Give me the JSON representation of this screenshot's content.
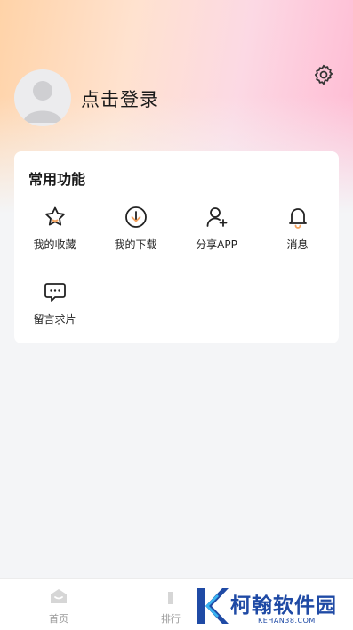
{
  "profile": {
    "login_text": "点击登录"
  },
  "features": {
    "title": "常用功能",
    "items": [
      {
        "label": "我的收藏",
        "icon": "star-icon"
      },
      {
        "label": "我的下载",
        "icon": "download-icon"
      },
      {
        "label": "分享APP",
        "icon": "user-add-icon"
      },
      {
        "label": "消息",
        "icon": "bell-icon"
      },
      {
        "label": "留言求片",
        "icon": "comment-icon"
      }
    ]
  },
  "tabbar": {
    "tabs": [
      {
        "label": "首页",
        "icon": "home-icon"
      },
      {
        "label": "排行",
        "icon": "ranking-icon"
      }
    ]
  },
  "watermark": {
    "title": "柯翰软件园",
    "subtitle": "KEHAN38.COM"
  },
  "colors": {
    "accent_orange": "#f5a25d",
    "watermark_blue": "#1f4aa5"
  }
}
